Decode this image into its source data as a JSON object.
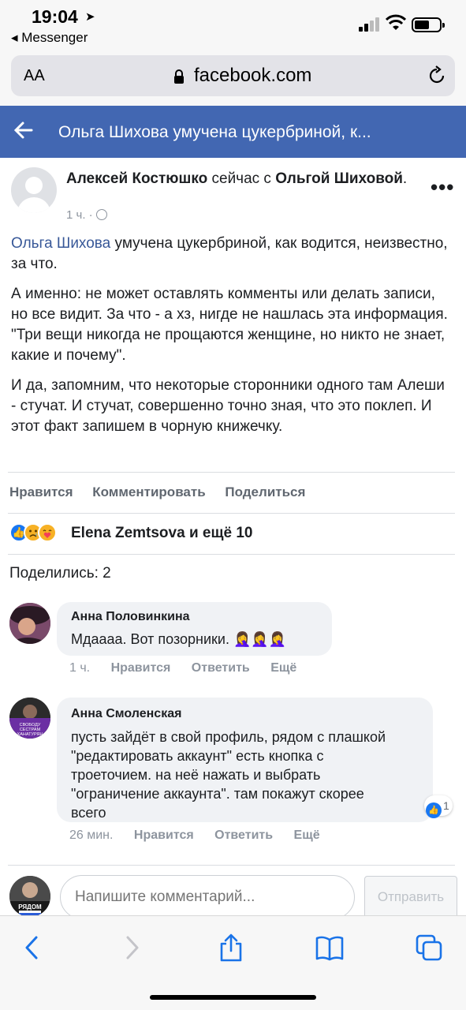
{
  "status_bar": {
    "time": "19:04",
    "back_app": "◂ Messenger"
  },
  "browser": {
    "text_size_label": "AA",
    "url": "facebook.com"
  },
  "fb_header": {
    "title": "Ольга Шихова умучена цукербриной, к..."
  },
  "post": {
    "author": "Алексей Костюшко",
    "with_text": "сейчас с",
    "tagged": "Ольгой Шиховой",
    "tagged_suffix": ".",
    "time": "1 ч. ·",
    "more": "•••",
    "mention": "Ольга Шихова",
    "para1_rest": " умучена цукербриной, как водится, неизвестно, за что.",
    "para2_line1": "А именно: не может оставлять комменты или делать записи, но все видит. За что - а хз, нигде не нашлась эта информация.",
    "para2_line2": "\"Три вещи никогда не прощаются женщине, но никто не знает, какие и почему\".",
    "para3": "И да, запомним, что некоторые сторонники одного там Алеши - стучат. И стучат, совершенно точно зная, что это поклеп. И этот факт запишем в чорную книжечку."
  },
  "actions": {
    "like": "Нравится",
    "comment": "Комментировать",
    "share": "Поделиться"
  },
  "reactions": {
    "text": "Elena Zemtsova и ещё 10",
    "like_icon": "👍"
  },
  "shares": {
    "text": "Поделились: 2"
  },
  "comments": [
    {
      "name": "Анна Половинкина",
      "text": "Мдаааа. Вот позорники.",
      "emoji": "🤦‍♀️🤦‍♀️🤦‍♀️",
      "time": "1 ч.",
      "like": "Нравится",
      "reply": "Ответить",
      "more": "Ещё"
    },
    {
      "name": "Анна Смоленская",
      "text": "пусть зайдёт в свой профиль, рядом с плашкой \"редактировать аккаунт\" есть кнопка с троеточием. на неё нажать и выбрать \"ограничение аккаунта\". там покажут скорее всего",
      "avatar_text": "СВОБОДУ СЕСТРАМ ХАНАТУРЯН",
      "likes": "1",
      "time": "26 мин.",
      "like": "Нравится",
      "reply": "Ответить",
      "more": "Ещё"
    }
  ],
  "composer": {
    "placeholder": "Напишите комментарий...",
    "send": "Отправить",
    "avatar_text": "РЯДОМ"
  },
  "colors": {
    "fb_blue": "#4267b2",
    "link": "#385898",
    "like_blue": "#1877f2",
    "ios_blue": "#1a73e8"
  }
}
